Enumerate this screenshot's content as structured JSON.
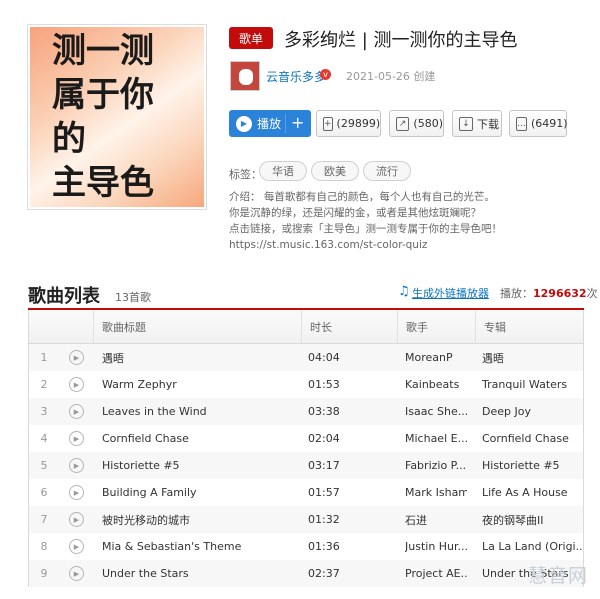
{
  "cover": {
    "text": "测一测\n属于你的\n主导色"
  },
  "playlist": {
    "badge": "歌单",
    "title": "多彩绚烂 | 测一测你的主导色",
    "creator": "云音乐多多",
    "vip_mark": "v",
    "created": "2021-05-26 创建"
  },
  "actions": {
    "play": "播放",
    "plus": "+",
    "collect": "(29899)",
    "share": "(580)",
    "download": "下载",
    "comment": "(6491)"
  },
  "tags": {
    "label": "标签：",
    "items": [
      "华语",
      "欧美",
      "流行"
    ]
  },
  "description": [
    "介绍：  每首歌都有自己的颜色，每个人也有自己的光芒。",
    "你是沉静的绿，还是闪耀的金，或者是其他炫斑斓呢？",
    "点击链接，或搜索「主导色」测一测专属于你的主导色吧！",
    "https://st.music.163.com/st-color-quiz"
  ],
  "list": {
    "title": "歌曲列表",
    "count": "13首歌",
    "gen_link": "生成外链播放器",
    "plays_label": "播放：",
    "plays_value": "1296632",
    "plays_unit": "次",
    "headers": {
      "title": "歌曲标题",
      "duration": "时长",
      "artist": "歌手",
      "album": "专辑"
    },
    "rows": [
      {
        "idx": "1",
        "title": "遇晤",
        "duration": "04:04",
        "artist": "MoreanP",
        "album": "遇晤"
      },
      {
        "idx": "2",
        "title": "Warm Zephyr",
        "duration": "01:53",
        "artist": "Kainbeats",
        "album": "Tranquil Waters"
      },
      {
        "idx": "3",
        "title": "Leaves in the Wind",
        "duration": "03:38",
        "artist": "Isaac She...",
        "album": "Deep Joy"
      },
      {
        "idx": "4",
        "title": "Cornfield Chase",
        "duration": "02:04",
        "artist": "Michael E...",
        "album": "Cornfield Chase"
      },
      {
        "idx": "5",
        "title": "Historiette #5",
        "duration": "03:17",
        "artist": "Fabrizio P...",
        "album": "Historiette #5"
      },
      {
        "idx": "6",
        "title": "Building A Family",
        "duration": "01:57",
        "artist": "Mark Isham",
        "album": "Life As A House"
      },
      {
        "idx": "7",
        "title": "被时光移动的城市",
        "duration": "01:32",
        "artist": "石进",
        "album": "夜的钢琴曲II"
      },
      {
        "idx": "8",
        "title": "Mia & Sebastian's Theme",
        "duration": "01:36",
        "artist": "Justin Hur...",
        "album": "La La Land (Origi..."
      },
      {
        "idx": "9",
        "title": "Under the Stars",
        "duration": "02:37",
        "artist": "Project AE...",
        "album": "Under the Stars"
      }
    ]
  },
  "watermark": "慧音网"
}
